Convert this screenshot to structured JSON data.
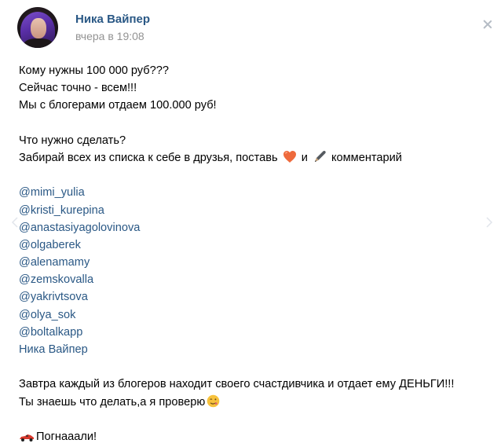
{
  "author": {
    "name": "Ника Вайпер",
    "time": "вчера в 19:08"
  },
  "colors": {
    "link": "#2a5885",
    "meta": "#939393",
    "text": "#000000"
  },
  "post": {
    "lines": [
      "Кому нужны 100 000 руб???",
      "Сейчас точно - всем!!!",
      "Мы с блогерами отдаем 100.000 руб!"
    ],
    "question": "Что нужно сделать?",
    "instruction_before": "Забирай всех из списка к себе в друзья, поставь",
    "instruction_and": "и",
    "instruction_after": "комментарий",
    "mentions": [
      "@mimi_yulia",
      "@kristi_kurepina",
      "@anastasiyagolovinova",
      "@olgaberek",
      "@alenamamy",
      "@zemskovalla",
      "@yakrivtsova",
      "@olya_sok",
      "@boltalkapp",
      "Ника Вайпер"
    ],
    "tomorrow": "Завтра каждый из блогеров находит своего счастдивчика и отдает ему ДЕНЬГИ!!!",
    "check": "Ты знаешь что делать,а я проверю",
    "go": "Погнааали!"
  },
  "icons": {
    "heart": "heart-emoji",
    "pen": "pen-emoji",
    "wink": "wink-emoji",
    "car": "race-car-emoji",
    "close": "close-icon",
    "prev": "chevron-left-icon",
    "next": "chevron-right-icon"
  }
}
